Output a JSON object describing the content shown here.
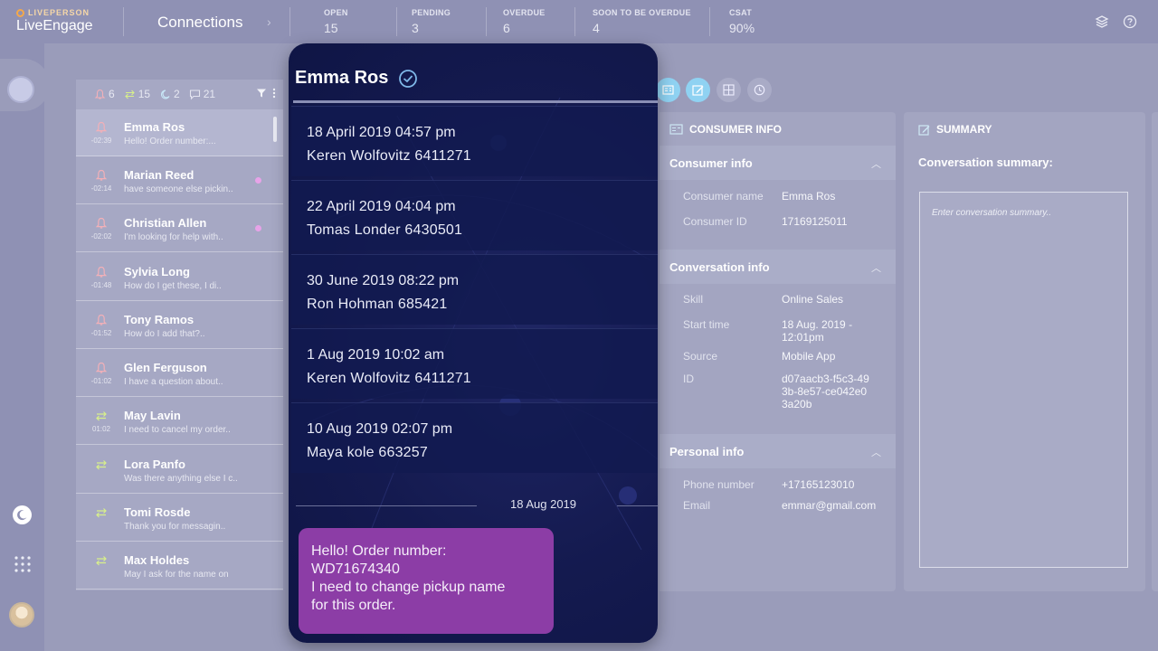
{
  "brand": {
    "top": "LIVEPERSON",
    "main": "LiveEngage"
  },
  "header": {
    "title": "Connections",
    "metrics": [
      {
        "label": "OPEN",
        "value": "15"
      },
      {
        "label": "PENDING",
        "value": "3"
      },
      {
        "label": "OVERDUE",
        "value": "6"
      },
      {
        "label": "SOON TO BE OVERDUE",
        "value": "4"
      },
      {
        "label": "CSAT",
        "value": "90%"
      }
    ]
  },
  "list": {
    "counts": {
      "alerts": "6",
      "transfers": "15",
      "away": "2",
      "chats": "21"
    },
    "conversations": [
      {
        "name": "Emma Ros",
        "time": "-02:39",
        "preview": "Hello! Order number:...",
        "icon": "bell-icon",
        "unread": false
      },
      {
        "name": "Marian Reed",
        "time": "-02:14",
        "preview": " have someone else pickin..",
        "icon": "bell-icon",
        "unread": true
      },
      {
        "name": "Christian Allen",
        "time": "-02:02",
        "preview": "I'm looking for help with..",
        "icon": "bell-icon",
        "unread": true
      },
      {
        "name": "Sylvia Long",
        "time": "-01:48",
        "preview": "How do I get these, I di..",
        "icon": "bell-icon",
        "unread": false
      },
      {
        "name": "Tony Ramos",
        "time": "-01:52",
        "preview": "How do I add that?..",
        "icon": "bell-icon",
        "unread": false
      },
      {
        "name": "Glen Ferguson",
        "time": "-01:02",
        "preview": "I have a question about..",
        "icon": "bell-icon",
        "unread": false
      },
      {
        "name": "May Lavin",
        "time": "01:02",
        "preview": "I need to cancel my order..",
        "icon": "transfer-icon",
        "unread": false
      },
      {
        "name": "Lora Panfo",
        "time": "",
        "preview": "Was there anything else I c..",
        "icon": "transfer-icon",
        "unread": false
      },
      {
        "name": "Tomi Rosde",
        "time": "",
        "preview": "Thank you for messagin..",
        "icon": "transfer-icon",
        "unread": false
      },
      {
        "name": "Max Holdes",
        "time": "",
        "preview": "May I ask for the name on",
        "icon": "transfer-icon",
        "unread": false
      }
    ]
  },
  "history": {
    "title": "Emma Ros",
    "records": [
      {
        "date": "18 April 2019 04:57 pm",
        "agent": "Keren Wolfovitz  6411271"
      },
      {
        "date": "22 April 2019 04:04 pm",
        "agent": "Tomas Londer  6430501"
      },
      {
        "date": "30 June 2019 08:22 pm",
        "agent": "Ron Hohman  685421"
      },
      {
        "date": "1 Aug 2019 10:02 am",
        "agent": "Keren Wolfovitz  6411271"
      },
      {
        "date": "10 Aug 2019 02:07 pm",
        "agent": "Maya kole  663257"
      }
    ],
    "separator_date": "18 Aug 2019",
    "message_lines": [
      "Hello! Order number:",
      "WD71674340",
      "I need to change pickup name",
      "for this order."
    ]
  },
  "consumer": {
    "panel_title": "CONSUMER INFO",
    "consumer_section": "Consumer info",
    "consumer_fields": [
      {
        "key": "Consumer name",
        "value": "Emma Ros"
      },
      {
        "key": "Consumer ID",
        "value": "17169125011"
      }
    ],
    "conversation_section": "Conversation info",
    "conversation_fields": [
      {
        "key": "Skill",
        "value": "Online Sales"
      },
      {
        "key": "Start time",
        "value": "18 Aug. 2019 - 12:01pm"
      },
      {
        "key": "Source",
        "value": "Mobile App"
      },
      {
        "key": "ID",
        "value": "d07aacb3-f5c3-493b-8e57-ce042e03a20b"
      }
    ],
    "personal_section": "Personal info",
    "personal_fields": [
      {
        "key": "Phone number",
        "value": "+17165123010"
      },
      {
        "key": "Email",
        "value": "emmar@gmail.com"
      }
    ]
  },
  "summary": {
    "panel_title": "SUMMARY",
    "label": "Conversation summary:",
    "placeholder": "Enter conversation summary.."
  },
  "colors": {
    "accent": "#8c3da6",
    "overlay_bg": "#141a4f",
    "active_action": "#8fd2f2"
  }
}
